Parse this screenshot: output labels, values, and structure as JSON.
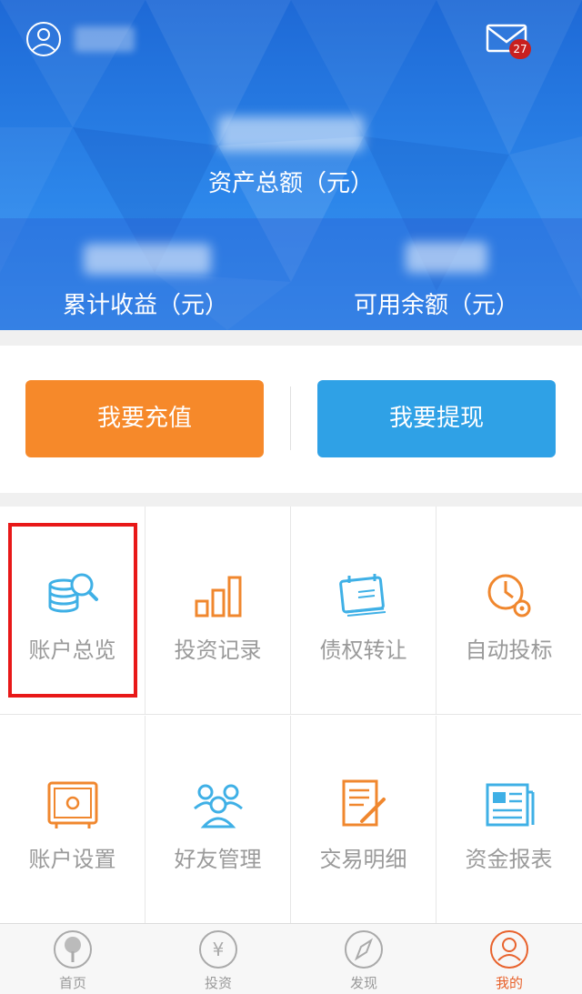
{
  "header": {
    "mail_badge": "27",
    "total_assets_label": "资产总额（元）",
    "accumulated_income_label": "累计收益（元）",
    "available_balance_label": "可用余额（元）"
  },
  "actions": {
    "recharge_label": "我要充值",
    "withdraw_label": "我要提现"
  },
  "menu": [
    {
      "label": "账户总览",
      "icon": "account-overview-icon"
    },
    {
      "label": "投资记录",
      "icon": "bar-chart-icon"
    },
    {
      "label": "债权转让",
      "icon": "calendar-icon"
    },
    {
      "label": "自动投标",
      "icon": "clock-gear-icon"
    },
    {
      "label": "账户设置",
      "icon": "safe-icon"
    },
    {
      "label": "好友管理",
      "icon": "friends-icon"
    },
    {
      "label": "交易明细",
      "icon": "document-pen-icon"
    },
    {
      "label": "资金报表",
      "icon": "report-icon"
    }
  ],
  "tabs": [
    {
      "label": "首页",
      "icon": "tree-icon"
    },
    {
      "label": "投资",
      "icon": "yen-icon"
    },
    {
      "label": "发现",
      "icon": "compass-icon"
    },
    {
      "label": "我的",
      "icon": "user-icon"
    }
  ],
  "colors": {
    "orange": "#f6892a",
    "blue": "#2fa1e6",
    "highlight": "#e81818",
    "active_tab": "#e8622c"
  }
}
